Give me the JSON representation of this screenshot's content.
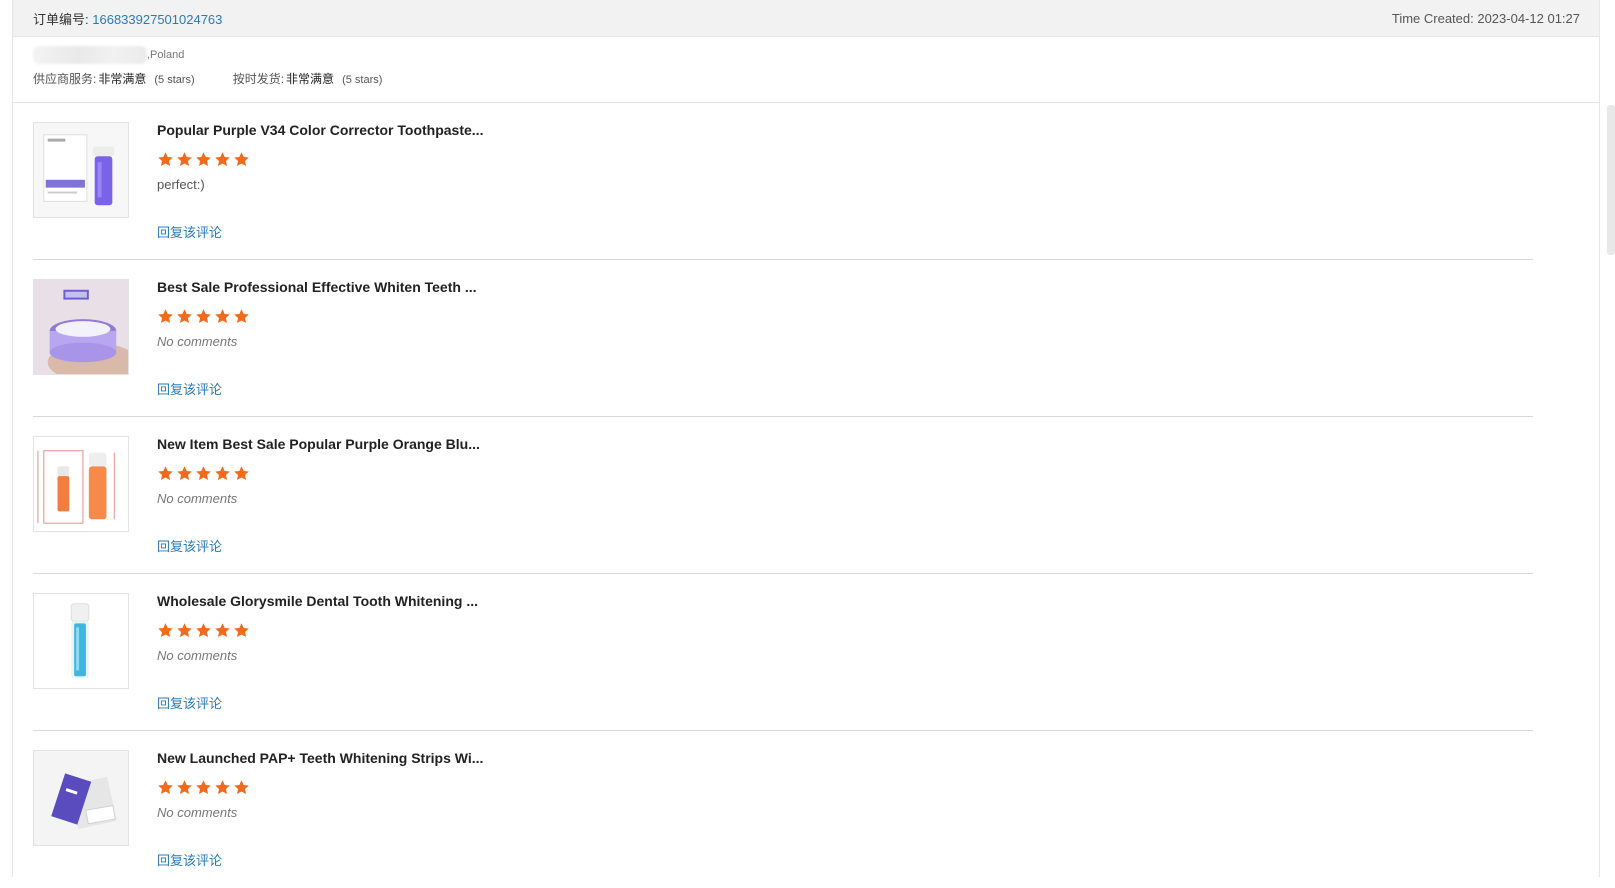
{
  "order": {
    "number_label": "订单编号:",
    "number": "166833927501024763",
    "time_created": "Time Created: 2023-04-12 01:27"
  },
  "buyer": {
    "country": ",Poland"
  },
  "ratings": [
    {
      "label": "供应商服务:",
      "value": "非常满意",
      "stars_text": "(5 stars)",
      "stars": 5
    },
    {
      "label": "按时发货:",
      "value": "非常满意",
      "stars_text": "(5 stars)",
      "stars": 5
    }
  ],
  "reviews": [
    {
      "title": "Popular Purple V34 Color Corrector Toothpaste...",
      "rating": 5,
      "comment": "perfect:)",
      "reply_label": "回复该评论",
      "thumb_icon": "purple-toothpaste-box-thumbnail"
    },
    {
      "title": "Best Sale Professional Effective Whiten Teeth ...",
      "rating": 5,
      "comment": "No comments",
      "reply_label": "回复该评论",
      "thumb_icon": "purple-jar-thumbnail"
    },
    {
      "title": "New Item Best Sale Popular Purple Orange Blu...",
      "rating": 5,
      "comment": "No comments",
      "reply_label": "回复该评论",
      "thumb_icon": "orange-bottles-thumbnail"
    },
    {
      "title": "Wholesale Glorysmile Dental Tooth Whitening ...",
      "rating": 5,
      "comment": "No comments",
      "reply_label": "回复该评论",
      "thumb_icon": "blue-bottle-thumbnail"
    },
    {
      "title": "New Launched PAP+ Teeth Whitening Strips Wi...",
      "rating": 5,
      "comment": "No comments",
      "reply_label": "回复该评论",
      "thumb_icon": "whitening-strips-thumbnail"
    }
  ],
  "colors": {
    "star": "#f26a1b",
    "link": "#2a7ab8",
    "header_bg": "#f2f2f2"
  }
}
